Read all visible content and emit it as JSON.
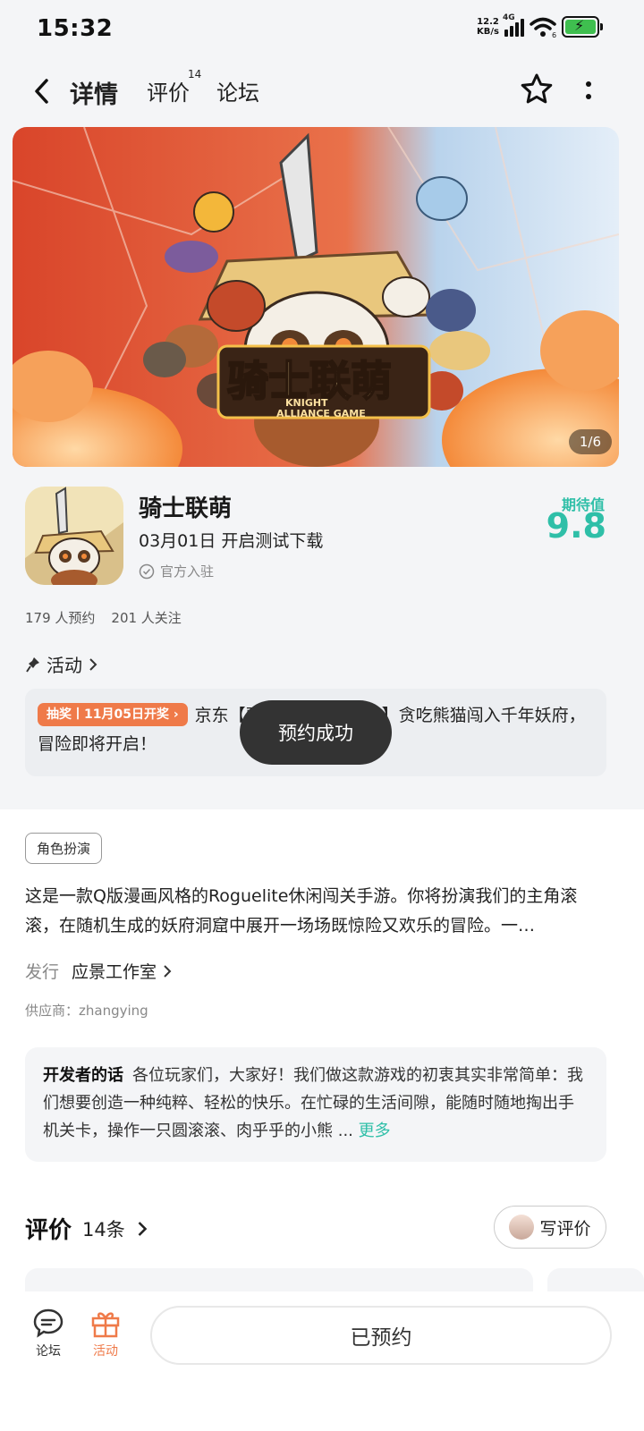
{
  "status_bar": {
    "time": "15:32",
    "net_speed_value": "12.2",
    "net_speed_unit": "KB/s",
    "network": "4G",
    "wifi_badge": "6"
  },
  "nav": {
    "tabs": [
      {
        "label": "详情",
        "active": true
      },
      {
        "label": "评价",
        "badge": "14"
      },
      {
        "label": "论坛"
      }
    ]
  },
  "banner": {
    "title_cn": "骑士联萌",
    "title_en_1": "KNIGHT",
    "title_en_2": "ALLIANCE GAME",
    "counter": "1/6"
  },
  "game": {
    "name": "骑士联萌",
    "release": "03月01日 开启测试下载",
    "official": "官方入驻",
    "expect_label": "期待值",
    "expect_score": "9.8",
    "reservations": "179 人预约",
    "followers": "201 人关注"
  },
  "activity": {
    "header": "活动",
    "badge": "抽奖丨11月05日开奖",
    "text": "京东【骑士联萌预约公告】贪吃熊猫闯入千年妖府，冒险即将开启！"
  },
  "toast": "预约成功",
  "details": {
    "tag": "角色扮演",
    "description": "这是一款Q版漫画风格的Roguelite休闲闯关手游。你将扮演我们的主角滚滚，在随机生成的妖府洞窟中展开一场场既惊险又欢乐的冒险。一…",
    "publisher_label": "发行",
    "publisher_value": "应景工作室",
    "supplier": "供应商：zhangying"
  },
  "developer_note": {
    "label": "开发者的话",
    "text": "各位玩家们，大家好！我们做这款游戏的初衷其实非常简单：我们想要创造一种纯粹、轻松的快乐。在忙碌的生活间隙，能随时随地掏出手机关卡，操作一只圆滚滚、肉乎乎的小熊 ...",
    "more": "更多"
  },
  "reviews": {
    "title": "评价",
    "count": "14条",
    "write_label": "写评价"
  },
  "bottom_bar": {
    "forum_label": "论坛",
    "activity_label": "活动",
    "reserved_label": "已预约"
  },
  "colors": {
    "accent": "#2fbfa8",
    "orange": "#ef7a49",
    "toast": "#333333"
  }
}
